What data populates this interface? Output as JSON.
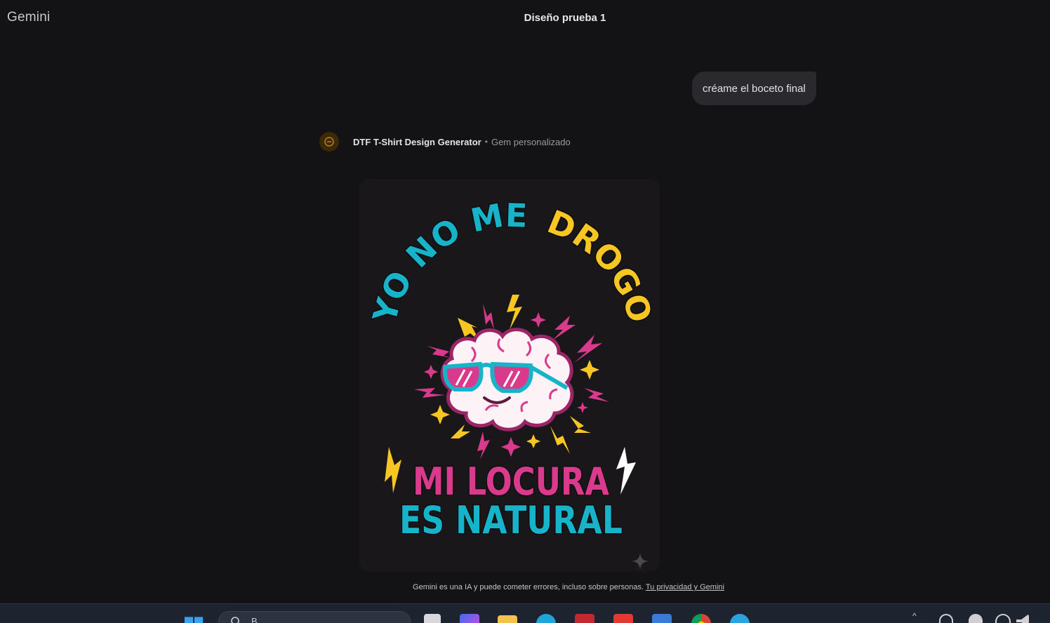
{
  "app": {
    "name": "Gemini"
  },
  "conversation": {
    "title": "Diseño prueba 1"
  },
  "user_message": {
    "text": "créame el boceto final"
  },
  "response": {
    "gem_name": "DTF T-Shirt Design Generator",
    "separator": "•",
    "gem_type": "Gem personalizado"
  },
  "design_image": {
    "line_top_teal": "YO NO ME",
    "line_top_yellow": "DROGO",
    "line_middle": "MI LOCURA",
    "line_bottom": "ES NATURAL",
    "colors": {
      "teal": "#17b3c9",
      "yellow": "#f7c623",
      "magenta": "#d93a8c",
      "white": "#ffffff",
      "card": "#19171a"
    }
  },
  "footer": {
    "disclaimer": "Gemini es una IA y puede cometer errores, incluso sobre personas.",
    "privacy_link": "Tu privacidad y Gemini"
  },
  "taskbar": {
    "search_placeholder": "B",
    "icons": [
      "windows-start-icon",
      "search-icon",
      "file-icon",
      "copilot-icon",
      "folder-icon",
      "edge-icon",
      "gmail-icon",
      "red-app-icon",
      "blue-app-icon",
      "chrome-icon",
      "telegram-icon",
      "chevron-up-icon",
      "sync-icon",
      "cloud-icon",
      "wifi-icon",
      "volume-icon"
    ]
  }
}
